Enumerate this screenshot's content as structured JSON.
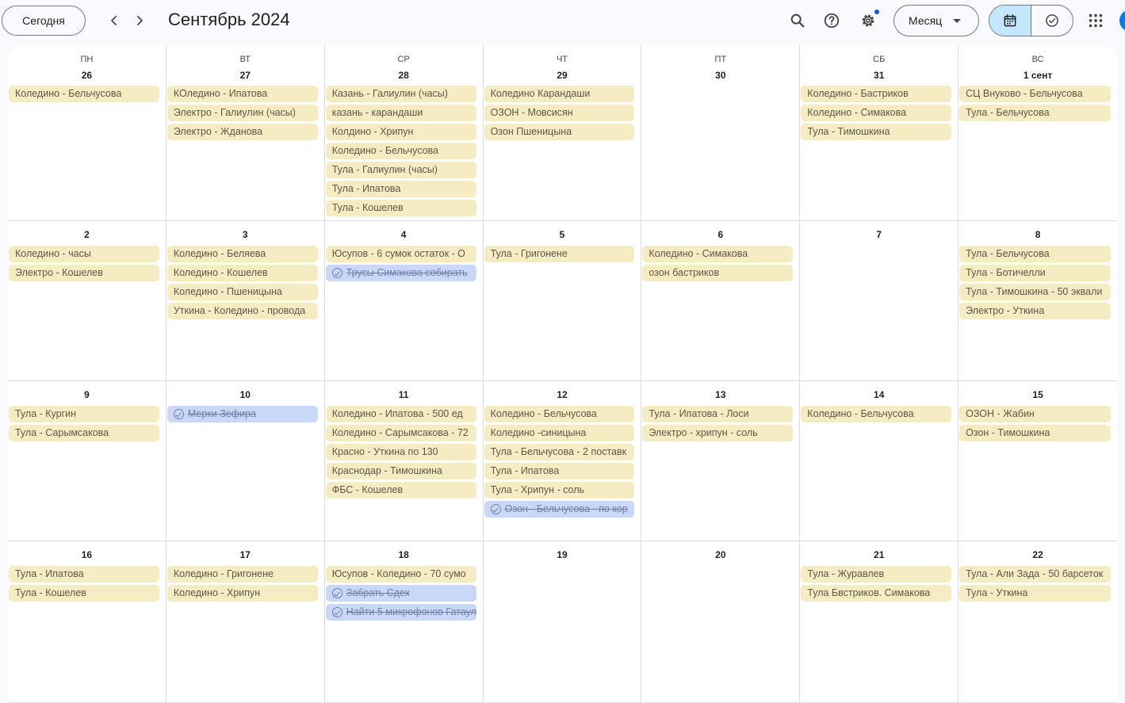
{
  "toolbar": {
    "today_label": "Сегодня",
    "title": "Сентябрь 2024",
    "view_label": "Месяц",
    "icons": [
      "search-icon",
      "help-icon",
      "settings-icon",
      "calendar-icon",
      "tasks-icon",
      "apps-icon"
    ]
  },
  "colors": {
    "event_bg": "#f6ecc4",
    "task_bg": "#c9d8f6",
    "active_toggle": "#c2e7ff",
    "avatar": "#0b7bd6"
  },
  "weekdays": [
    "ПН",
    "ВТ",
    "СР",
    "ЧТ",
    "ПТ",
    "СБ",
    "ВС"
  ],
  "weeks": [
    [
      {
        "day": "26",
        "events": [
          {
            "title": "Коледино - Бельчусова"
          }
        ]
      },
      {
        "day": "27",
        "events": [
          {
            "title": "КОледино - Ипатова"
          },
          {
            "title": "Электро - Галиулин (часы)"
          },
          {
            "title": "Электро - Жданова"
          }
        ]
      },
      {
        "day": "28",
        "events": [
          {
            "title": "Казань - Галиулин (часы)"
          },
          {
            "title": "казань - карандаши"
          },
          {
            "title": "Колдино - Хрипун"
          },
          {
            "title": "Коледино - Бельчусова"
          },
          {
            "title": "Тула - Галиулин (часы)"
          },
          {
            "title": "Тула - Ипатова"
          },
          {
            "title": "Тула - Кошелев"
          }
        ]
      },
      {
        "day": "29",
        "events": [
          {
            "title": "Коледино Карандаши"
          },
          {
            "title": "ОЗОН - Мовсисян"
          },
          {
            "title": "Озон Пшеницына"
          }
        ]
      },
      {
        "day": "30",
        "events": []
      },
      {
        "day": "31",
        "events": [
          {
            "title": "Коледино - Бастриков"
          },
          {
            "title": "Коледино - Симакова"
          },
          {
            "title": "Тула - Тимошкина"
          }
        ]
      },
      {
        "day": "1 сент",
        "events": [
          {
            "title": "СЦ Внуково - Бельчусова"
          },
          {
            "title": "Тула - Бельчусова"
          }
        ]
      }
    ],
    [
      {
        "day": "2",
        "events": [
          {
            "title": "Коледино - часы"
          },
          {
            "title": "Электро - Кошелев"
          }
        ]
      },
      {
        "day": "3",
        "events": [
          {
            "title": "Коледино - Беляева"
          },
          {
            "title": "Коледино - Кошелев"
          },
          {
            "title": "Коледино - Пшеницына"
          },
          {
            "title": "Уткина - Коледино - провода"
          }
        ]
      },
      {
        "day": "4",
        "events": [
          {
            "title": "Юсупов - 6 сумок остаток - О"
          },
          {
            "title": "Трусы Симакова собирать",
            "task": true
          }
        ]
      },
      {
        "day": "5",
        "events": [
          {
            "title": "Тула - Григонене"
          }
        ]
      },
      {
        "day": "6",
        "events": [
          {
            "title": "Коледино - Симакова"
          },
          {
            "title": "озон бастриков"
          }
        ]
      },
      {
        "day": "7",
        "events": []
      },
      {
        "day": "8",
        "events": [
          {
            "title": "Тула - Бельчусова"
          },
          {
            "title": "Тула - Ботичелли"
          },
          {
            "title": "Тула - Тимошкина - 50 эквали"
          },
          {
            "title": "Электро - Уткина"
          }
        ]
      }
    ],
    [
      {
        "day": "9",
        "events": [
          {
            "title": "Тула - Кургин"
          },
          {
            "title": "Тула - Сарымсакова"
          }
        ]
      },
      {
        "day": "10",
        "events": [
          {
            "title": "Мерки Зефира",
            "task": true
          }
        ]
      },
      {
        "day": "11",
        "events": [
          {
            "title": "Коледино - Ипатова - 500 ед"
          },
          {
            "title": "Коледино - Сарымсакова - 72"
          },
          {
            "title": "Красно - Уткина по 130"
          },
          {
            "title": "Краснодар - Тимошкина"
          },
          {
            "title": "ФБС - Кошелев"
          }
        ]
      },
      {
        "day": "12",
        "events": [
          {
            "title": "Коледино - Бельчусова"
          },
          {
            "title": "Коледино -синицына"
          },
          {
            "title": "Тула - Бельчусова - 2 поставк"
          },
          {
            "title": "Тула - Ипатова"
          },
          {
            "title": "Тула - Хрипун - соль"
          },
          {
            "title": "Озон - Бельчусова - по кор",
            "task": true
          }
        ]
      },
      {
        "day": "13",
        "events": [
          {
            "title": "Тула - Ипатова - Лоси"
          },
          {
            "title": "Электро - хрипун - соль"
          }
        ]
      },
      {
        "day": "14",
        "events": [
          {
            "title": "Коледино - Бельчусова"
          }
        ]
      },
      {
        "day": "15",
        "events": [
          {
            "title": "ОЗОН - Жабин"
          },
          {
            "title": "Озон - Тимошкина"
          }
        ]
      }
    ],
    [
      {
        "day": "16",
        "events": [
          {
            "title": "Тула - Ипатова"
          },
          {
            "title": "Тула - Кошелев"
          }
        ]
      },
      {
        "day": "17",
        "events": [
          {
            "title": "Коледино - Григонене"
          },
          {
            "title": "Коледино - Хрипун"
          }
        ]
      },
      {
        "day": "18",
        "events": [
          {
            "title": "Юсупов - Коледино - 70 сумо"
          },
          {
            "title": "Забрать Сдек",
            "task": true
          },
          {
            "title": "Найти 5 микрофонов Гатаул",
            "task": true
          }
        ]
      },
      {
        "day": "19",
        "events": []
      },
      {
        "day": "20",
        "events": []
      },
      {
        "day": "21",
        "events": [
          {
            "title": "Тула - Журавлев"
          },
          {
            "title": "Тула Бвстриков. Симакова"
          }
        ]
      },
      {
        "day": "22",
        "events": [
          {
            "title": "Тула - Али Зада - 50 барсеток"
          },
          {
            "title": "Тула - Уткина"
          }
        ]
      }
    ]
  ]
}
